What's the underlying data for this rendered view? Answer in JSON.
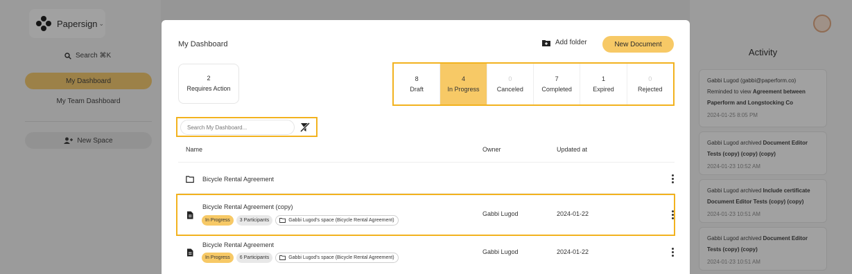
{
  "app": {
    "brand": "Papersign",
    "search_label": "Search ⌘K",
    "nav": [
      {
        "label": "My Dashboard",
        "active": true
      },
      {
        "label": "My Team Dashboard",
        "active": false
      }
    ],
    "new_space_label": "New Space"
  },
  "activity": {
    "title": "Activity",
    "items": [
      {
        "text_plain": "Gabbi Lugod (gabbi@paperform.co) Reminded to view ",
        "text_bold": "Agreement between Paperform and Longstocking Co",
        "time": "2024-01-25 8:05 PM"
      },
      {
        "text_plain": "Gabbi Lugod archived ",
        "text_bold": "Document Editor Tests (copy) (copy) (copy)",
        "time": "2024-01-23 10:52 AM"
      },
      {
        "text_plain": "Gabbi Lugod archived ",
        "text_bold": "Include certificate Document Editor Tests (copy) (copy)",
        "time": "2024-01-23 10:51 AM"
      },
      {
        "text_plain": "Gabbi Lugod archived ",
        "text_bold": "Document Editor Tests (copy) (copy)",
        "time": "2024-01-23 10:51 AM"
      }
    ]
  },
  "modal": {
    "title": "My Dashboard",
    "add_folder_label": "Add folder",
    "new_document_label": "New Document",
    "requires_action": {
      "count": "2",
      "label": "Requires Action"
    },
    "stats": [
      {
        "count": "8",
        "label": "Draft",
        "active": false,
        "muted": false
      },
      {
        "count": "4",
        "label": "In Progress",
        "active": true,
        "muted": false
      },
      {
        "count": "0",
        "label": "Canceled",
        "active": false,
        "muted": true
      },
      {
        "count": "7",
        "label": "Completed",
        "active": false,
        "muted": false
      },
      {
        "count": "1",
        "label": "Expired",
        "active": false,
        "muted": false
      },
      {
        "count": "0",
        "label": "Rejected",
        "active": false,
        "muted": true
      }
    ],
    "search_placeholder": "Search My Dashboard...",
    "table": {
      "headers": {
        "name": "Name",
        "owner": "Owner",
        "updated": "Updated at"
      },
      "rows": [
        {
          "type": "folder",
          "name": "Bicycle Rental Agreement"
        },
        {
          "type": "document",
          "name": "Bicycle Rental Agreement (copy)",
          "status": "In Progress",
          "participants": "3 Participants",
          "space": "Gabbi Lugod's space (Bicycle Rental Agreement)",
          "owner": "Gabbi Lugod",
          "updated": "2024-01-22"
        },
        {
          "type": "document",
          "name": "Bicycle Rental Agreement",
          "status": "In Progress",
          "participants": "6 Participants",
          "space": "Gabbi Lugod's space (Bicycle Rental Agreement)",
          "owner": "Gabbi Lugod",
          "updated": "2024-01-22"
        }
      ]
    }
  },
  "colors": {
    "accent": "#f7c966",
    "highlight": "#f2b21e"
  }
}
